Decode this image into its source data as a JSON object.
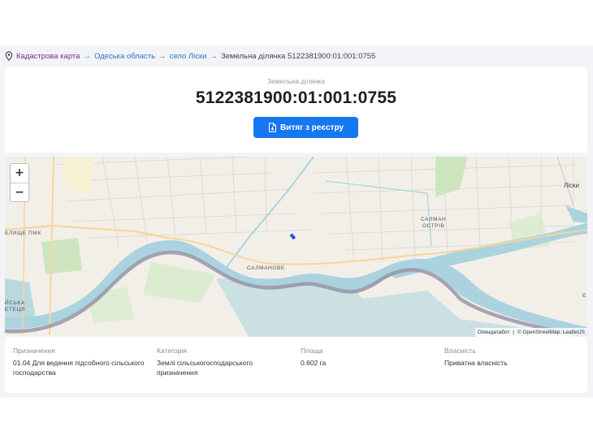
{
  "breadcrumb": {
    "items": [
      "Кадастрова карта",
      "Одеська область",
      "село Ліски"
    ],
    "separator": "→",
    "current": "Земельна ділянка 5122381900:01:001:0755"
  },
  "parcel": {
    "subtitle": "Земельна ділянка",
    "id": "5122381900:01:001:0755",
    "extract_button": "Витяг з реєстру"
  },
  "map": {
    "zoom_in": "+",
    "zoom_out": "−",
    "labels": {
      "lisky": "Ліски",
      "salman_island_1": "САЛМАН",
      "salman_island_2": "ОСТРІВ",
      "salmanove": "САЛМАНОВЕ",
      "left_top": "ЕЛИЩЕ ПМК",
      "left_bottom_1": "ЙСЬКА",
      "left_bottom_2": "ЕТЕЦЯ",
      "right_edge": "Є"
    },
    "attribution": {
      "first": "Опендатабот",
      "separator": "|",
      "second": "© OpenStreetMap, LeafletJS"
    },
    "colors": {
      "water": "#aad3df",
      "land": "#f2efe9",
      "parcel": "#1f5ad6",
      "boundary": "#9a95a8"
    }
  },
  "properties": [
    {
      "label": "Призначення",
      "value": "01.04 Для ведення підсобного сільського господарства"
    },
    {
      "label": "Категорія",
      "value": "Землі сільськогосподарського призначення"
    },
    {
      "label": "Площа",
      "value": "0.602 га"
    },
    {
      "label": "Власність",
      "value": "Приватна власність"
    }
  ]
}
